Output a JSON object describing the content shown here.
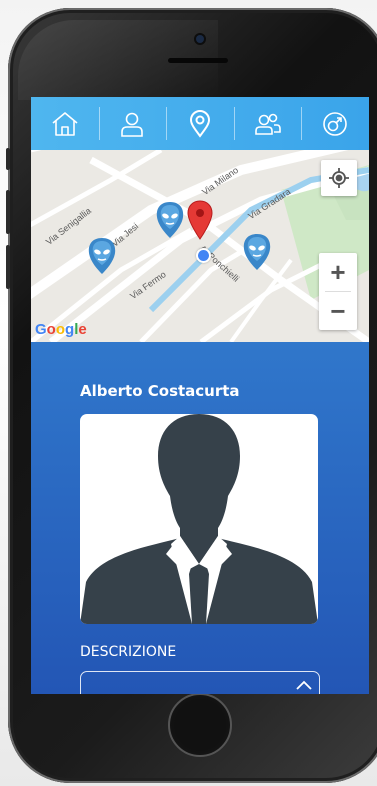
{
  "nav": {
    "items": [
      {
        "name": "home",
        "icon": "home-icon"
      },
      {
        "name": "profile",
        "icon": "user-icon"
      },
      {
        "name": "map",
        "icon": "location-pin-icon"
      },
      {
        "name": "users",
        "icon": "users-icon"
      },
      {
        "name": "gender",
        "icon": "gender-icon"
      }
    ]
  },
  "map": {
    "streets": [
      "Via Milano",
      "Via Gradara",
      "Via Senigallia",
      "Via Jesi",
      "A. Ponchielli",
      "Via Fermo"
    ],
    "logo": "Google",
    "zoom_in": "+",
    "zoom_out": "−",
    "markers": [
      "alien-marker-icon",
      "alien-marker-icon",
      "alien-marker-icon"
    ],
    "pin": "red-location-pin-icon"
  },
  "profile": {
    "name": "Alberto Costacurta",
    "photo": "person-silhouette-icon"
  },
  "description": {
    "label": "DESCRIZIONE",
    "value": ""
  },
  "colors": {
    "nav_bg": "#3aa4ea",
    "screen_top": "#3a8fd9",
    "screen_bottom": "#2356b5",
    "pin": "#e53935"
  }
}
